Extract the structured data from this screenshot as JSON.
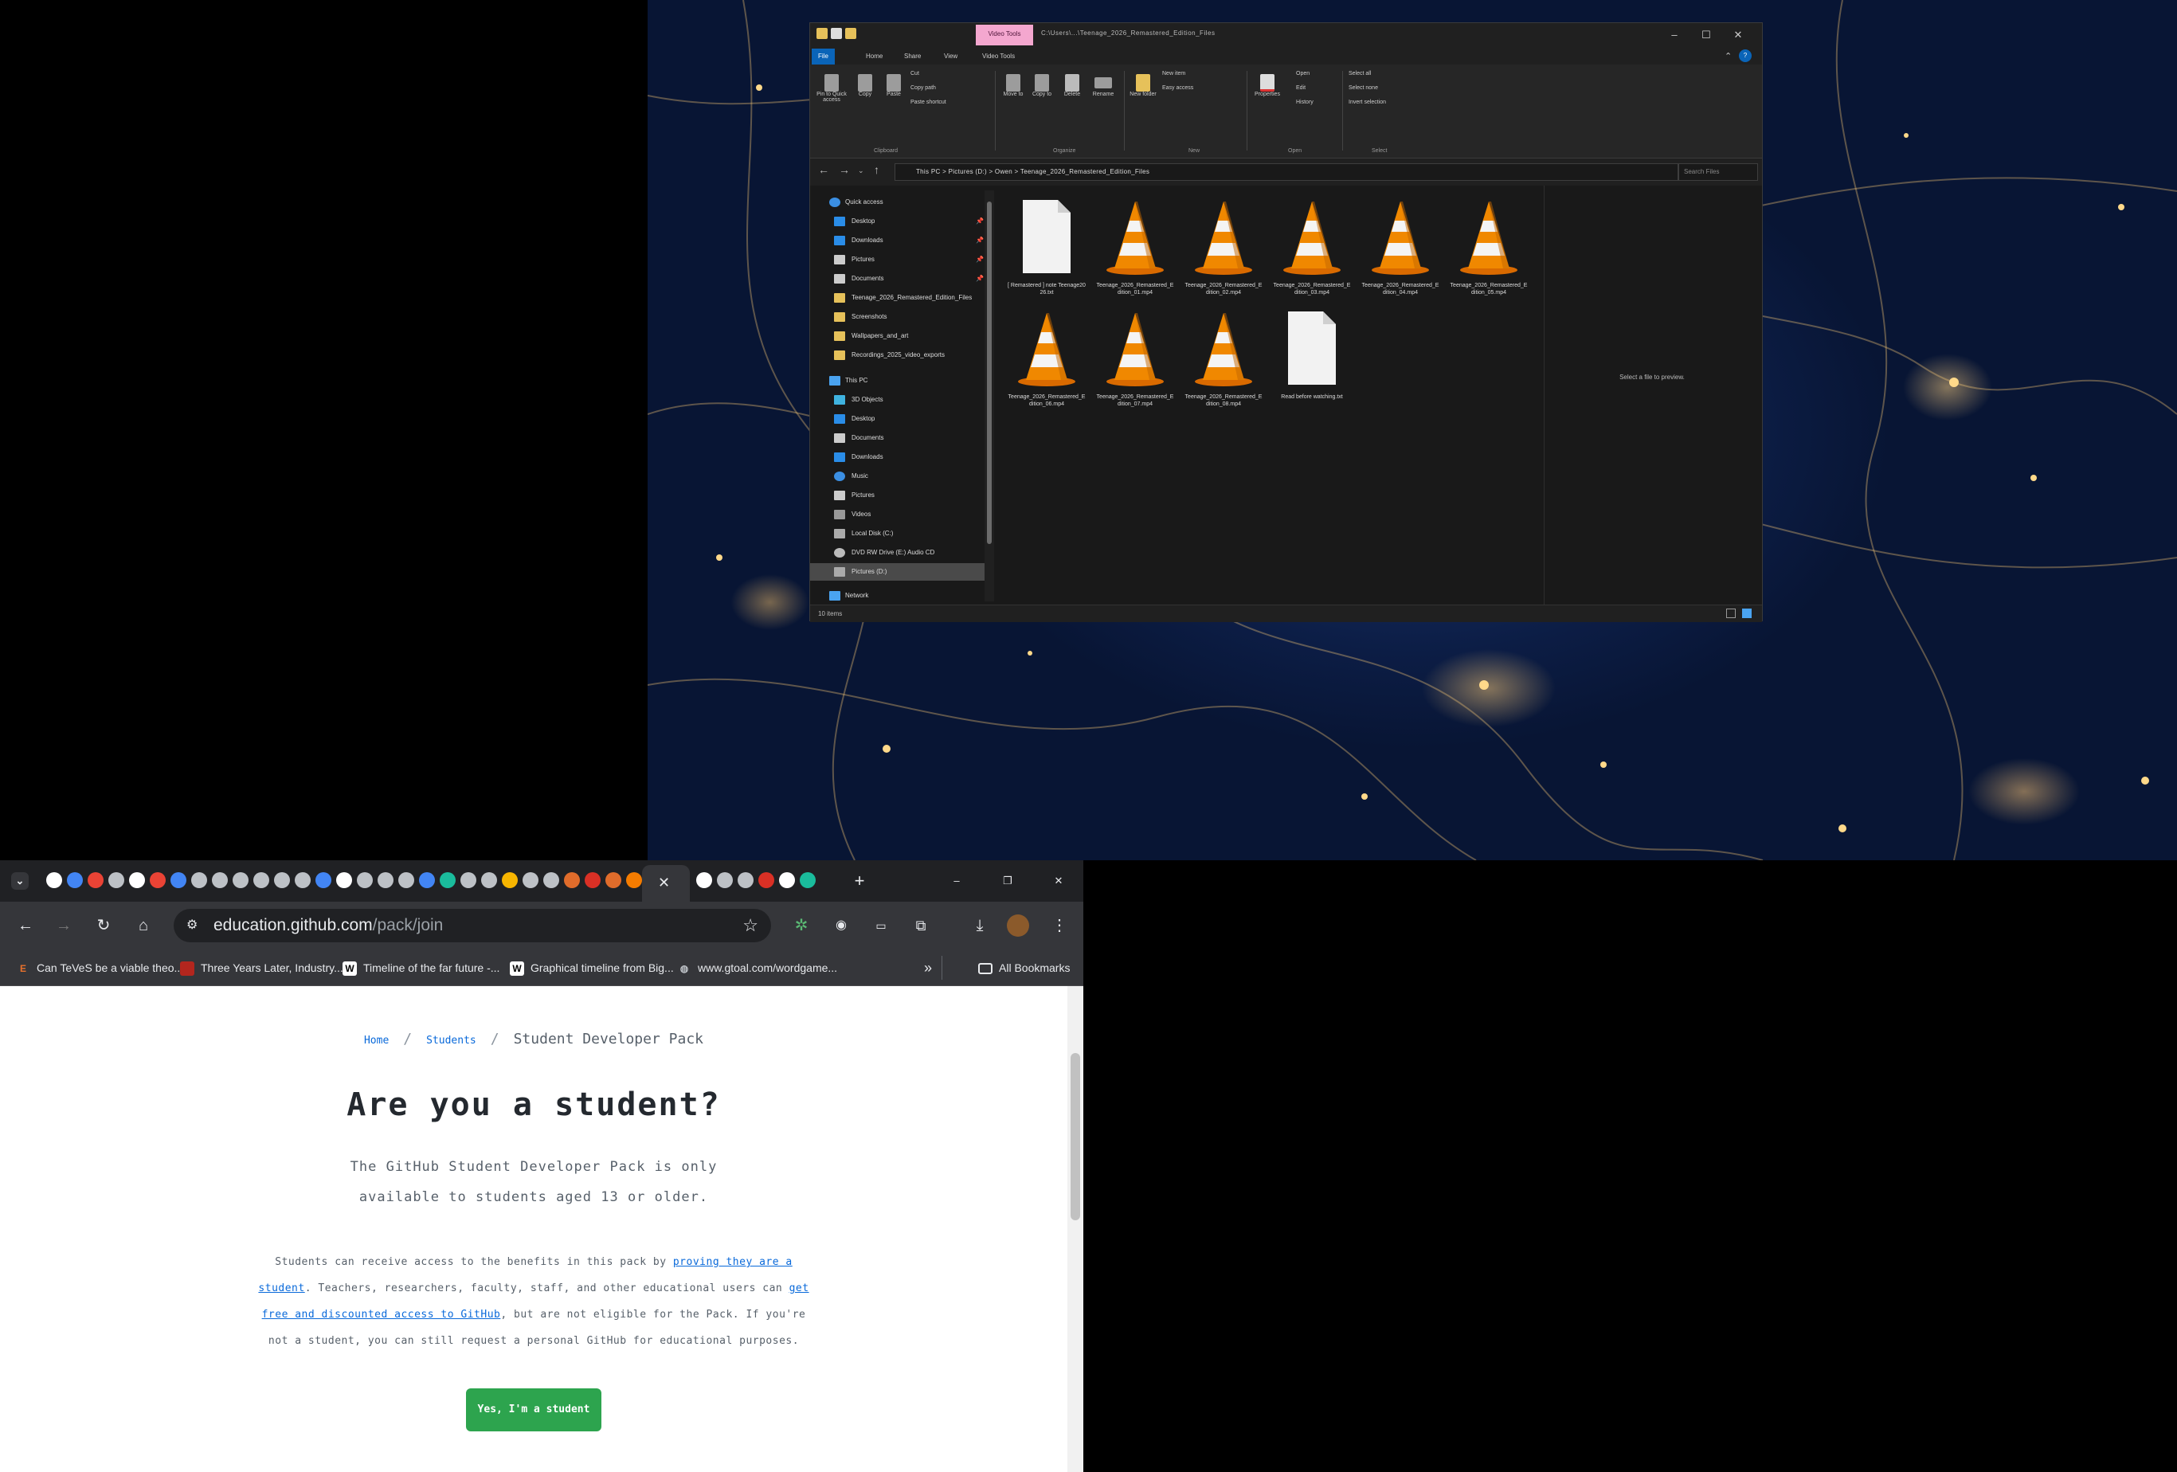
{
  "explorer": {
    "title_path": "C:\\Users\\...\\Teenage_2026_Remastered_Edition_Files",
    "context_tab": "Video Tools",
    "tabs": [
      "File",
      "Home",
      "Share",
      "View",
      "Video Tools"
    ],
    "ribbon_groups": [
      "Clipboard",
      "Organize",
      "New",
      "Open",
      "Select"
    ],
    "ribbon_items": {
      "pin": "Pin to Quick access",
      "copy": "Copy",
      "paste": "Paste",
      "cut": "Cut",
      "copy_path": "Copy path",
      "paste_shortcut": "Paste shortcut",
      "move_to": "Move to",
      "copy_to": "Copy to",
      "delete": "Delete",
      "rename": "Rename",
      "new_folder": "New folder",
      "new_item": "New item",
      "easy_access": "Easy access",
      "properties": "Properties",
      "open": "Open",
      "edit": "Edit",
      "history": "History",
      "select_all": "Select all",
      "select_none": "Select none",
      "invert_selection": "Invert selection"
    },
    "address": "This PC  >  Pictures (D:)  >  Owen  >  Teenage_2026_Remastered_Edition_Files",
    "search_placeholder": "Search Files",
    "nav": {
      "quick_access": "Quick access",
      "pinned": [
        "Desktop",
        "Downloads",
        "Pictures",
        "Documents"
      ],
      "folders": [
        "Teenage_2026_Remastered_Edition_Files",
        "Screenshots",
        "Wallpapers_and_art",
        "Recordings_2025_video_exports"
      ],
      "this_pc": "This PC",
      "pc_items": [
        "3D Objects",
        "Desktop",
        "Documents",
        "Downloads",
        "Music",
        "Pictures",
        "Videos",
        "Local Disk (C:)",
        "DVD RW Drive (E:) Audio CD",
        "Pictures (D:)"
      ],
      "network": "Network"
    },
    "files": [
      {
        "name": "[ Remastered ] note Teenage2026.txt",
        "type": "doc"
      },
      {
        "name": "Teenage_2026_Remastered_Edition_01.mp4",
        "type": "vlc"
      },
      {
        "name": "Teenage_2026_Remastered_Edition_02.mp4",
        "type": "vlc"
      },
      {
        "name": "Teenage_2026_Remastered_Edition_03.mp4",
        "type": "vlc"
      },
      {
        "name": "Teenage_2026_Remastered_Edition_04.mp4",
        "type": "vlc"
      },
      {
        "name": "Teenage_2026_Remastered_Edition_05.mp4",
        "type": "vlc"
      },
      {
        "name": "Teenage_2026_Remastered_Edition_06.mp4",
        "type": "vlc"
      },
      {
        "name": "Teenage_2026_Remastered_Edition_07.mp4",
        "type": "vlc"
      },
      {
        "name": "Teenage_2026_Remastered_Edition_08.mp4",
        "type": "vlc"
      },
      {
        "name": "Read before watching.txt",
        "type": "doc"
      }
    ],
    "preview_text": "Select a file to preview.",
    "status": "10 items"
  },
  "browser": {
    "url_host": "education.github.com",
    "url_path": "/pack/join",
    "bookmarks": [
      {
        "label": "Can TeVeS be a viable theo...",
        "icon": "E",
        "color": "#e8712c"
      },
      {
        "label": "Three Years Later, Industry...",
        "icon": "",
        "color": "#b3261e"
      },
      {
        "label": "Timeline of the far future -...",
        "icon": "W",
        "color": "#ffffff"
      },
      {
        "label": "Graphical timeline from Big...",
        "icon": "W",
        "color": "#ffffff"
      },
      {
        "label": "www.gtoal.com/wordgame...",
        "icon": "◍",
        "color": "#bdc1c6"
      }
    ],
    "all_bookmarks": "All Bookmarks",
    "page": {
      "crumb_home": "Home",
      "crumb_students": "Students",
      "crumb_current": "Student Developer Pack",
      "heading": "Are you a student?",
      "lead": "The GitHub Student Developer Pack is only available to students aged 13 or older.",
      "body_pre": "Students can receive access to the benefits in this pack by ",
      "body_link1": "proving they are a student",
      "body_mid": ". Teachers, researchers, faculty, staff, and other educational users can ",
      "body_link2": "get free and discounted access to GitHub",
      "body_post": ", but are not eligible for the Pack. If you're not a student, you can still request a personal GitHub for educational purposes.",
      "cta": "Yes, I'm a student"
    }
  }
}
